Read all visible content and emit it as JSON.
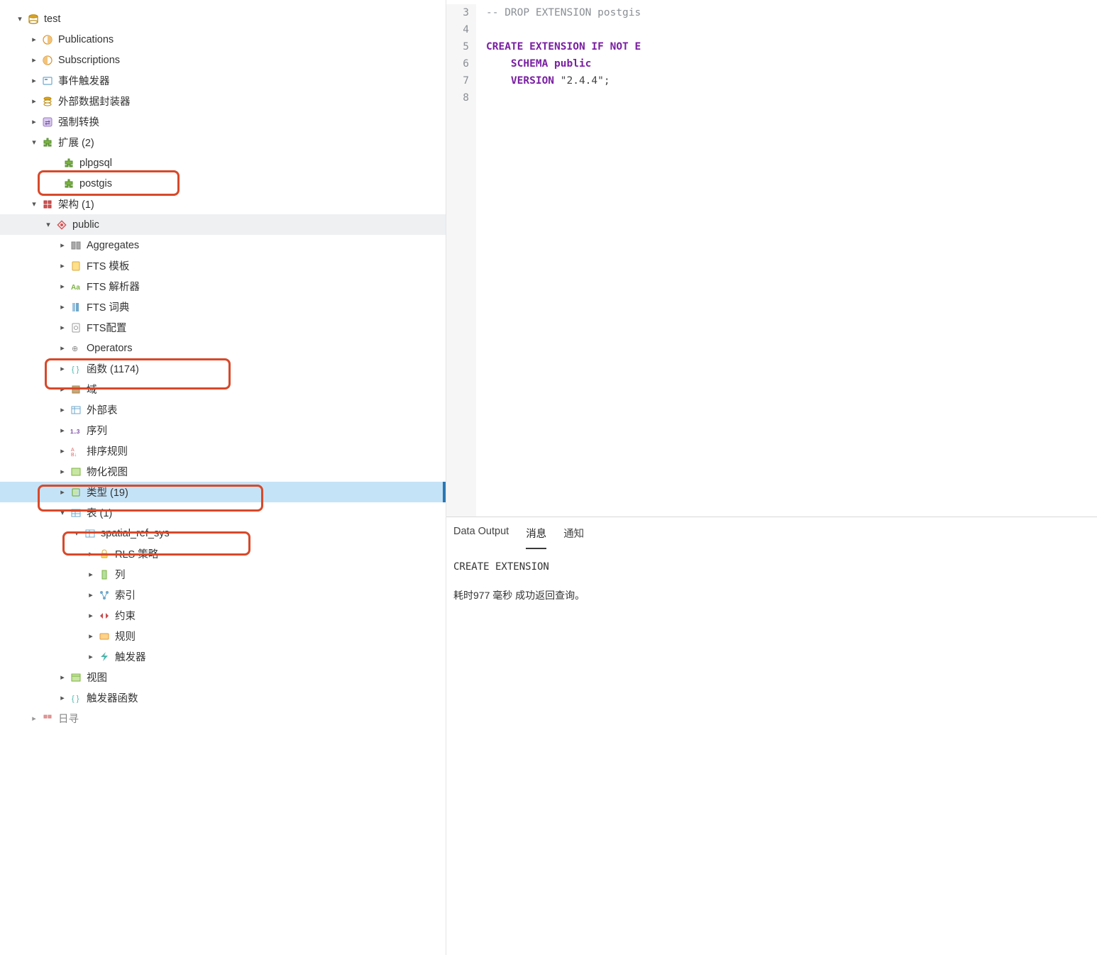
{
  "tree": {
    "root": {
      "label": "test"
    },
    "publications": {
      "label": "Publications"
    },
    "subscriptions": {
      "label": "Subscriptions"
    },
    "event_triggers": {
      "label": "事件触发器"
    },
    "fdw": {
      "label": "外部数据封装器"
    },
    "casts": {
      "label": "强制转换"
    },
    "extensions": {
      "label": "扩展 (2)"
    },
    "ext_plpgsql": {
      "label": "plpgsql"
    },
    "ext_postgis": {
      "label": "postgis"
    },
    "schemas": {
      "label": "架构 (1)"
    },
    "schema_public": {
      "label": "public"
    },
    "aggregates": {
      "label": "Aggregates"
    },
    "fts_templates": {
      "label": "FTS 模板"
    },
    "fts_parsers": {
      "label": "FTS 解析器"
    },
    "fts_dict": {
      "label": "FTS 词典"
    },
    "fts_config": {
      "label": "FTS配置"
    },
    "operators": {
      "label": "Operators"
    },
    "functions": {
      "label": "函数 (1174)"
    },
    "domains": {
      "label": "域"
    },
    "foreign_tables": {
      "label": "外部表"
    },
    "sequences": {
      "label": "序列"
    },
    "collations": {
      "label": "排序规则"
    },
    "matviews": {
      "label": "物化视图"
    },
    "types": {
      "label": "类型 (19)"
    },
    "tables": {
      "label": "表 (1)"
    },
    "table_spatial": {
      "label": "spatial_ref_sys"
    },
    "rls": {
      "label": "RLS 策略"
    },
    "columns": {
      "label": "列"
    },
    "indexes": {
      "label": "索引"
    },
    "constraints": {
      "label": "约束"
    },
    "rules": {
      "label": "规则"
    },
    "triggers": {
      "label": "触发器"
    },
    "views": {
      "label": "视图"
    },
    "trigger_funcs": {
      "label": "触发器函数"
    },
    "catalogs": {
      "label": "日寻"
    }
  },
  "code": {
    "lines": [
      {
        "n": "3",
        "seg": [
          {
            "cls": "tok-comment",
            "t": "-- DROP EXTENSION postgis"
          }
        ]
      },
      {
        "n": "4",
        "seg": []
      },
      {
        "n": "5",
        "seg": [
          {
            "cls": "tok-kw",
            "t": "CREATE EXTENSION IF NOT E"
          }
        ]
      },
      {
        "n": "6",
        "seg": [
          {
            "cls": "",
            "t": "    "
          },
          {
            "cls": "tok-kw",
            "t": "SCHEMA public"
          }
        ]
      },
      {
        "n": "7",
        "seg": [
          {
            "cls": "",
            "t": "    "
          },
          {
            "cls": "tok-kw",
            "t": "VERSION "
          },
          {
            "cls": "tok-str",
            "t": "\"2.4.4\""
          },
          {
            "cls": "tok-punc",
            "t": ";"
          }
        ]
      },
      {
        "n": "8",
        "seg": []
      }
    ]
  },
  "output_tabs": {
    "data": "Data Output",
    "messages": "消息",
    "notifications": "通知"
  },
  "output": {
    "line1": "CREATE EXTENSION",
    "line2": "耗时977 毫秒  成功返回查询。"
  }
}
